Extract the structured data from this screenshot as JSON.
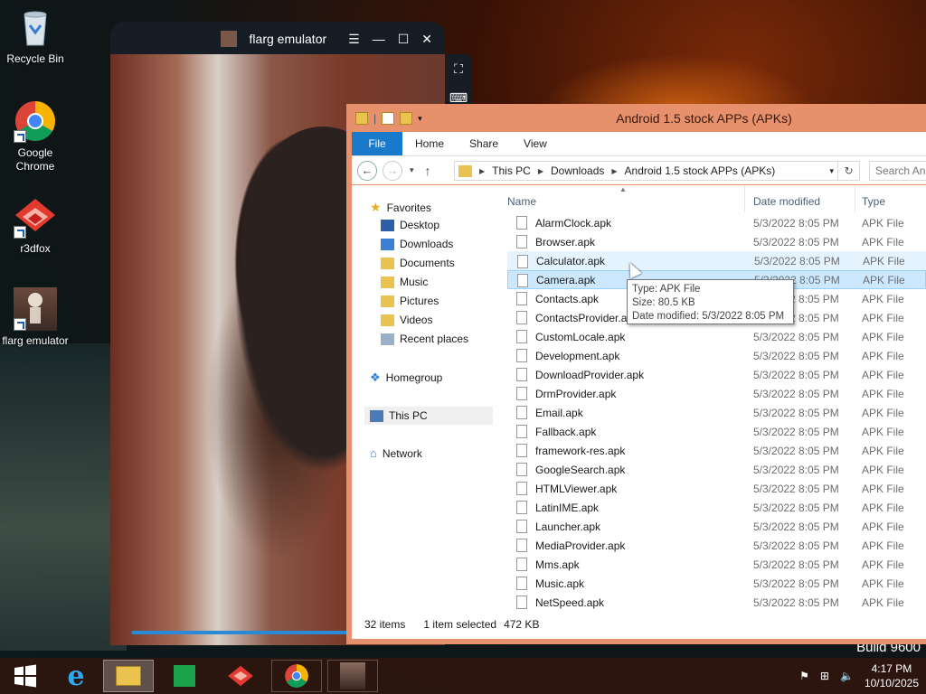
{
  "desktop": {
    "icons": [
      {
        "label": "Recycle Bin"
      },
      {
        "label": "Google Chrome"
      },
      {
        "label": "r3dfox"
      },
      {
        "label": "flarg emulator"
      }
    ],
    "build_text": "Build 9600"
  },
  "emulator": {
    "title": "flarg emulator"
  },
  "explorer": {
    "title": "Android 1.5 stock APPs (APKs)",
    "ribbon_tabs": [
      "File",
      "Home",
      "Share",
      "View"
    ],
    "breadcrumb": [
      "This PC",
      "Downloads",
      "Android 1.5 stock APPs (APKs)"
    ],
    "search_placeholder": "Search And",
    "nav": {
      "favorites": "Favorites",
      "favorites_items": [
        "Desktop",
        "Downloads",
        "Documents",
        "Music",
        "Pictures",
        "Videos",
        "Recent places"
      ],
      "homegroup": "Homegroup",
      "this_pc": "This PC",
      "network": "Network"
    },
    "columns": {
      "name": "Name",
      "date": "Date modified",
      "type": "Type"
    },
    "files": [
      {
        "name": "AlarmClock.apk",
        "date": "5/3/2022 8:05 PM",
        "type": "APK File"
      },
      {
        "name": "Browser.apk",
        "date": "5/3/2022 8:05 PM",
        "type": "APK File"
      },
      {
        "name": "Calculator.apk",
        "date": "5/3/2022 8:05 PM",
        "type": "APK File"
      },
      {
        "name": "Camera.apk",
        "date": "5/3/2022 8:05 PM",
        "type": "APK File"
      },
      {
        "name": "Contacts.apk",
        "date": "5/3/2022 8:05 PM",
        "type": "APK File"
      },
      {
        "name": "ContactsProvider.apk",
        "date": "5/3/2022 8:05 PM",
        "type": "APK File"
      },
      {
        "name": "CustomLocale.apk",
        "date": "5/3/2022 8:05 PM",
        "type": "APK File"
      },
      {
        "name": "Development.apk",
        "date": "5/3/2022 8:05 PM",
        "type": "APK File"
      },
      {
        "name": "DownloadProvider.apk",
        "date": "5/3/2022 8:05 PM",
        "type": "APK File"
      },
      {
        "name": "DrmProvider.apk",
        "date": "5/3/2022 8:05 PM",
        "type": "APK File"
      },
      {
        "name": "Email.apk",
        "date": "5/3/2022 8:05 PM",
        "type": "APK File"
      },
      {
        "name": "Fallback.apk",
        "date": "5/3/2022 8:05 PM",
        "type": "APK File"
      },
      {
        "name": "framework-res.apk",
        "date": "5/3/2022 8:05 PM",
        "type": "APK File"
      },
      {
        "name": "GoogleSearch.apk",
        "date": "5/3/2022 8:05 PM",
        "type": "APK File"
      },
      {
        "name": "HTMLViewer.apk",
        "date": "5/3/2022 8:05 PM",
        "type": "APK File"
      },
      {
        "name": "LatinIME.apk",
        "date": "5/3/2022 8:05 PM",
        "type": "APK File"
      },
      {
        "name": "Launcher.apk",
        "date": "5/3/2022 8:05 PM",
        "type": "APK File"
      },
      {
        "name": "MediaProvider.apk",
        "date": "5/3/2022 8:05 PM",
        "type": "APK File"
      },
      {
        "name": "Mms.apk",
        "date": "5/3/2022 8:05 PM",
        "type": "APK File"
      },
      {
        "name": "Music.apk",
        "date": "5/3/2022 8:05 PM",
        "type": "APK File"
      },
      {
        "name": "NetSpeed.apk",
        "date": "5/3/2022 8:05 PM",
        "type": "APK File"
      }
    ],
    "tooltip": {
      "type": "Type: APK File",
      "size": "Size: 80.5 KB",
      "date": "Date modified: 5/3/2022 8:05 PM"
    },
    "status": {
      "count": "32 items",
      "selected": "1 item selected",
      "size": "472 KB"
    }
  },
  "taskbar": {
    "time": "4:17 PM",
    "date": "10/10/2025"
  },
  "colors": {
    "explorer_frame": "#e6906c",
    "selection": "#cce8ff",
    "file_tab": "#1979ca",
    "taskbar": "#2e160e"
  }
}
